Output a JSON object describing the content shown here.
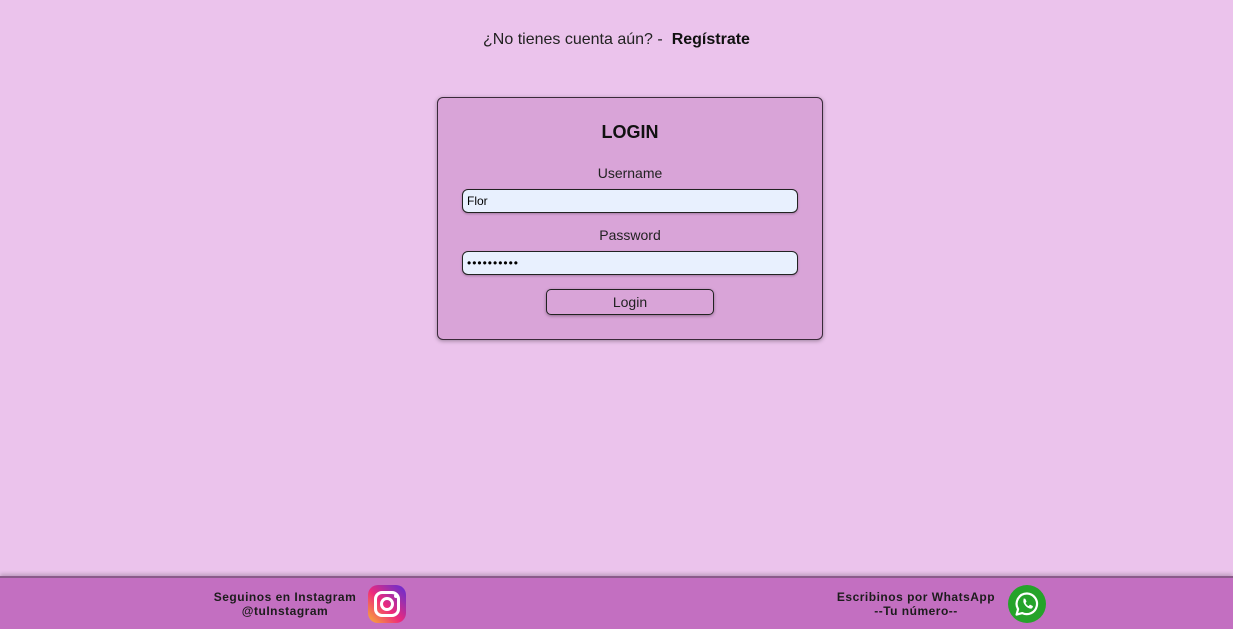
{
  "header": {
    "prompt": "¿No tienes cuenta aún? -",
    "register_link": "Regístrate"
  },
  "login": {
    "title": "LOGIN",
    "username_label": "Username",
    "username_value": "Flor",
    "password_label": "Password",
    "password_value": "••••••••••",
    "submit_label": "Login"
  },
  "footer": {
    "instagram_line1": "Seguinos en Instagram",
    "instagram_line2": "@tuInstagram",
    "instagram_icon": "instagram-icon",
    "whatsapp_line1": "Escribinos por WhatsApp",
    "whatsapp_line2": "--Tu número--",
    "whatsapp_icon": "whatsapp-icon"
  },
  "colors": {
    "page_background": "#ebc3ec",
    "card_background": "#d9a4d8",
    "input_background": "#e8f0fe",
    "footer_background": "#c36fc1",
    "whatsapp_green": "#25a32a"
  }
}
